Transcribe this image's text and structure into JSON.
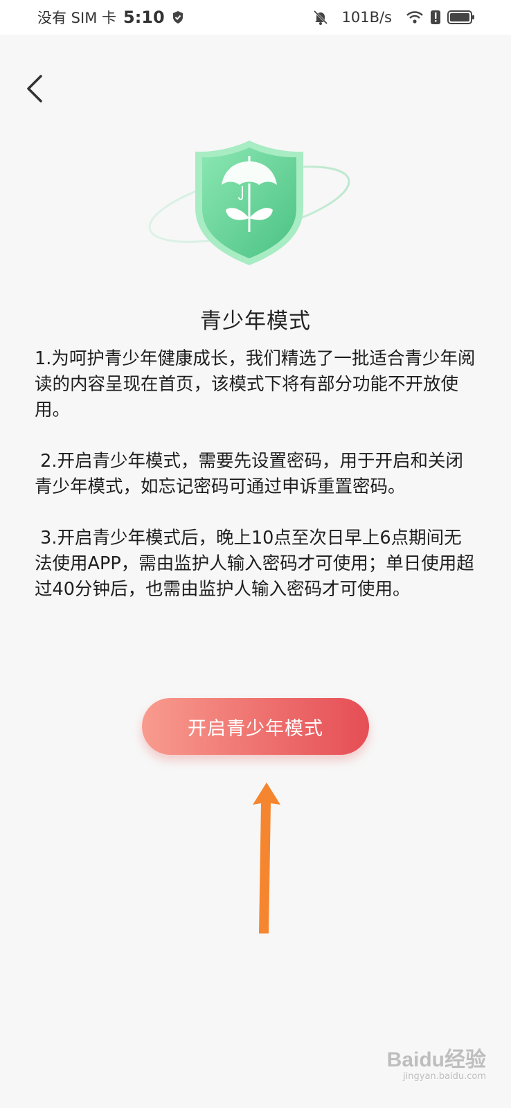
{
  "status_bar": {
    "carrier": "没有 SIM 卡",
    "time": "5:10",
    "net_speed": "101B/s"
  },
  "page": {
    "title": "青少年模式",
    "paragraphs": [
      "1.为呵护青少年健康成长，我们精选了一批适合青少年阅读的内容呈现在首页，该模式下将有部分功能不开放使用。",
      " 2.开启青少年模式，需要先设置密码，用于开启和关闭青少年模式，如忘记密码可通过申诉重置密码。",
      " 3.开启青少年模式后，晚上10点至次日早上6点期间无法使用APP，需由监护人输入密码才可使用；单日使用超过40分钟后，也需由监护人输入密码才可使用。"
    ],
    "primary_button": "开启青少年模式"
  },
  "watermark": {
    "logo": "Baidu经验",
    "url": "jingyan.baidu.com"
  },
  "colors": {
    "shield_green": "#5fcf8e",
    "button_start": "#f89b8e",
    "button_end": "#e54e55",
    "arrow_orange": "#f5862f"
  },
  "icons": [
    "shield-check-icon",
    "mute-bell-icon",
    "wifi-icon",
    "battery-icon",
    "back-chevron-icon",
    "umbrella-sprout-icon",
    "up-arrow-icon"
  ]
}
